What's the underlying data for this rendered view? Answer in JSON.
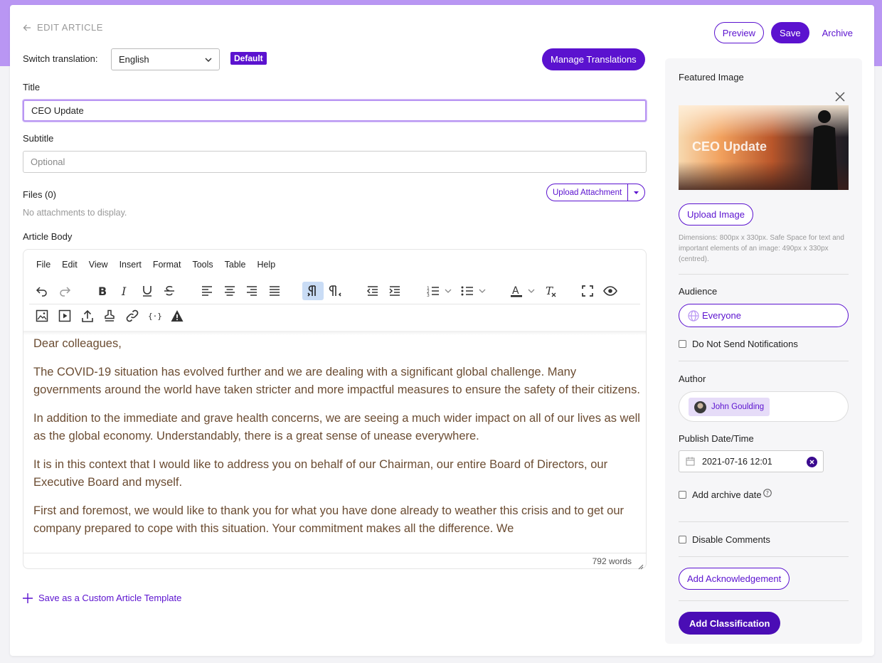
{
  "header": {
    "back_label": "EDIT ARTICLE",
    "preview_label": "Preview",
    "save_label": "Save",
    "archive_label": "Archive"
  },
  "translation": {
    "label": "Switch translation:",
    "selected": "English",
    "default_badge": "Default",
    "manage_label": "Manage Translations"
  },
  "title": {
    "label": "Title",
    "value": "CEO Update"
  },
  "subtitle": {
    "label": "Subtitle",
    "placeholder": "Optional"
  },
  "files": {
    "label": "Files (0)",
    "empty_text": "No attachments to display.",
    "upload_label": "Upload Attachment"
  },
  "body": {
    "label": "Article Body",
    "menu": [
      "File",
      "Edit",
      "View",
      "Insert",
      "Format",
      "Tools",
      "Table",
      "Help"
    ],
    "paragraphs": [
      "Dear colleagues,",
      "The COVID-19 situation has evolved further and we are dealing with a significant global challenge. Many governments around the world have taken stricter and more impactful measures to ensure the safety of their citizens.",
      "In addition to the immediate and grave health concerns, we are seeing a much wider impact on all of our lives as well as the global economy. Understandably, there is a great sense of unease everywhere.",
      "It is in this context that I would like to address you on behalf of our Chairman, our entire Board of Directors, our Executive Board and myself.",
      "First and foremost, we would like to thank you for what you have done already to weather this crisis and to get our company prepared to cope with this situation. Your commitment makes all the difference. We"
    ],
    "word_count": "792 words"
  },
  "template_link": "Save as a Custom Article Template",
  "sidebar": {
    "featured_label": "Featured Image",
    "image_caption": "CEO Update",
    "upload_image_label": "Upload Image",
    "dimensions_note": "Dimensions: 800px x 330px. Safe Space for text and important elements of an image: 490px x 330px (centred).",
    "audience_label": "Audience",
    "audience_value": "Everyone",
    "no_notify_label": "Do Not Send Notifications",
    "author_label": "Author",
    "author_name": "John Goulding",
    "publish_label": "Publish Date/Time",
    "publish_value": "2021-07-16 12:01",
    "archive_date_label": "Add archive date",
    "disable_comments_label": "Disable Comments",
    "ack_label": "Add Acknowledgement",
    "classification_label": "Add Classification"
  },
  "colors": {
    "accent": "#5b12cf",
    "band": "#b996f3",
    "body_text": "#6b4c32"
  }
}
